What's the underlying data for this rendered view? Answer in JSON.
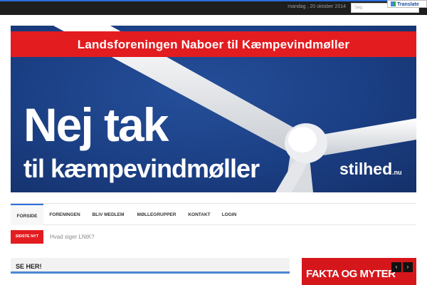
{
  "topbar": {
    "date": "mandag , 20 oktober 2014",
    "search_placeholder": "Søg",
    "translate_label": "Translate"
  },
  "banner": {
    "headline": "Landsforeningen Naboer til Kæmpevindmøller",
    "slogan_line1": "Nej tak",
    "slogan_line2": "til kæmpevindmøller",
    "logo_text": "stilhed",
    "logo_sub": ".nu"
  },
  "nav": {
    "items": [
      "FORSIDE",
      "FORENINGEN",
      "BLIV MEDLEM",
      "MØLLEGRUPPER",
      "KONTAKT",
      "LOGIN"
    ]
  },
  "ticker": {
    "label": "SIDSTE NYT",
    "text": "Hvad siger LNtK?"
  },
  "sections": {
    "se_her": "SE HER!",
    "fakta": "FAKTA OG MYTER"
  },
  "colors": {
    "accent_blue": "#2a6fdb",
    "brand_red": "#e31c20",
    "banner_blue": "#1b3f84"
  }
}
